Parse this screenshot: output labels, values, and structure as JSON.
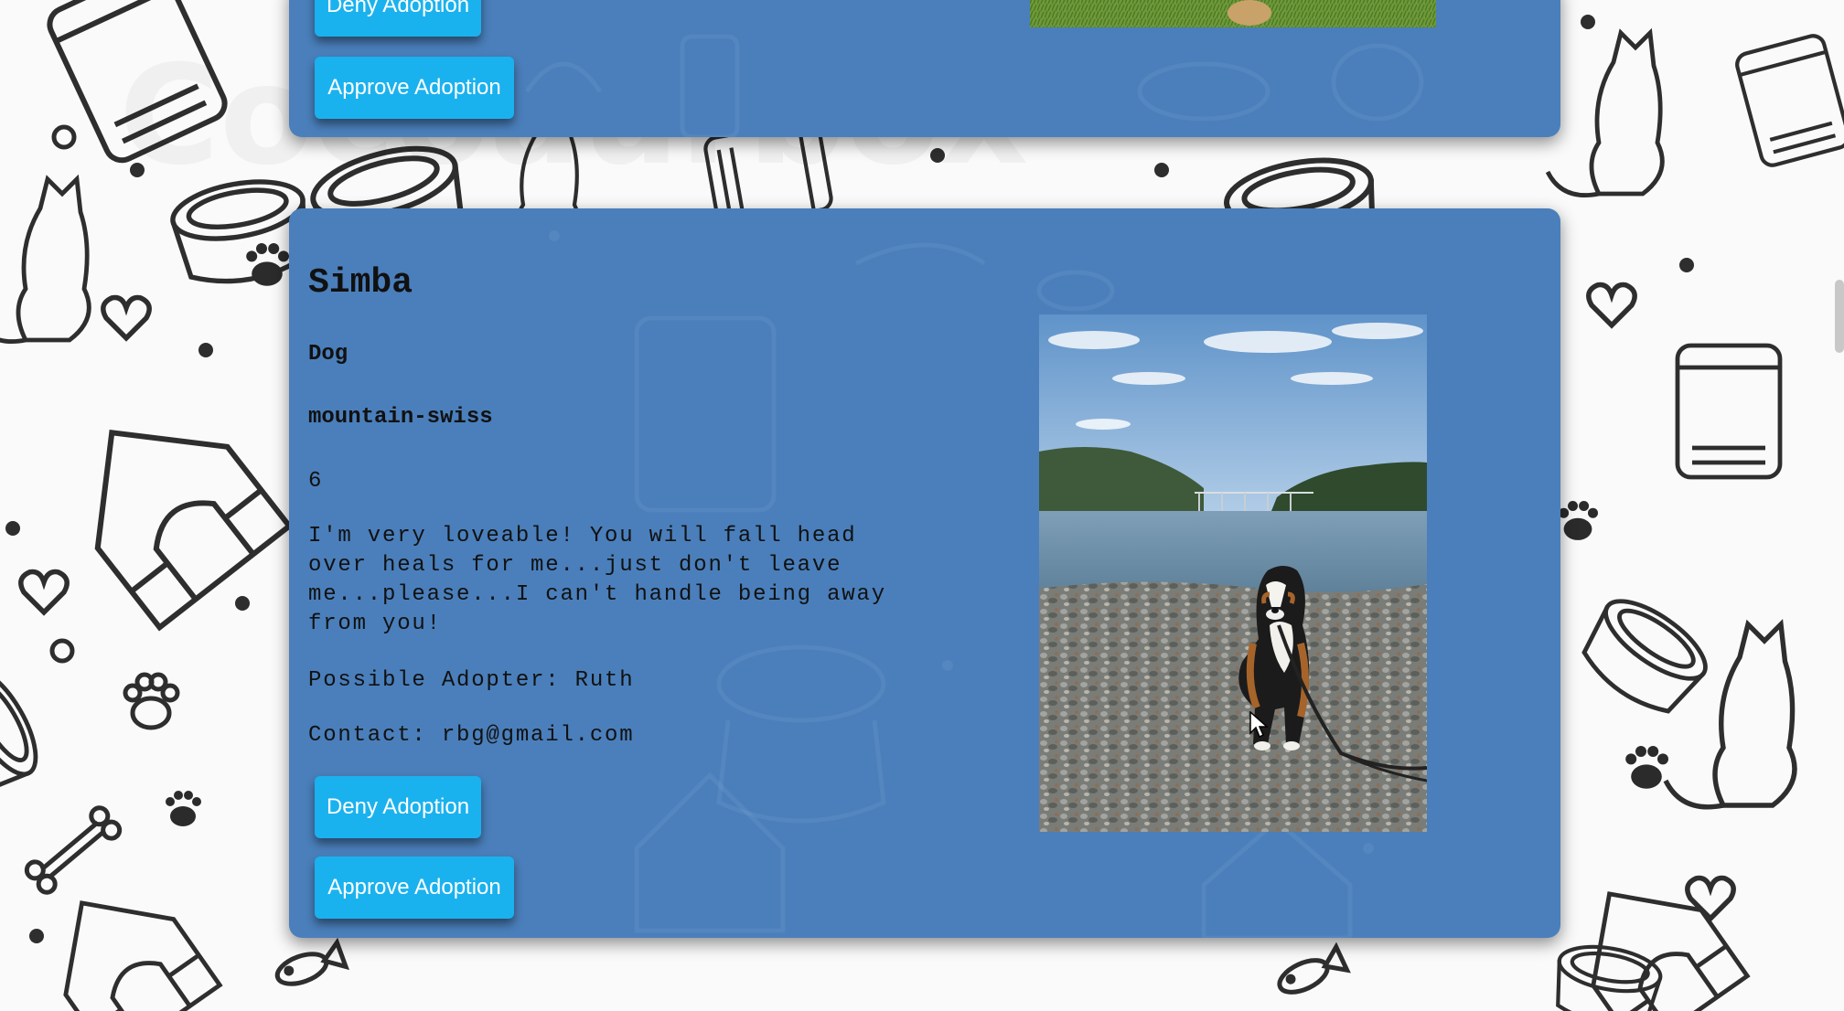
{
  "previous_card": {
    "deny_label": "Deny Adoption",
    "approve_label": "Approve Adoption"
  },
  "pet": {
    "name": "Simba",
    "type": "Dog",
    "breed": "mountain-swiss",
    "age": "6",
    "description": "I'm very loveable! You will fall head over heals for me...just don't leave me...please...I can't handle being away from you!",
    "adopter": "Possible Adopter: Ruth",
    "contact": "Contact: rbg@gmail.com",
    "deny_label": "Deny Adoption",
    "approve_label": "Approve Adoption",
    "photo_icon": "dog-photo"
  },
  "colors": {
    "card": "#4a7fbb",
    "button": "#1ab2ee",
    "button_text": "#ffffff",
    "pattern_stroke": "#2e2e2e"
  }
}
